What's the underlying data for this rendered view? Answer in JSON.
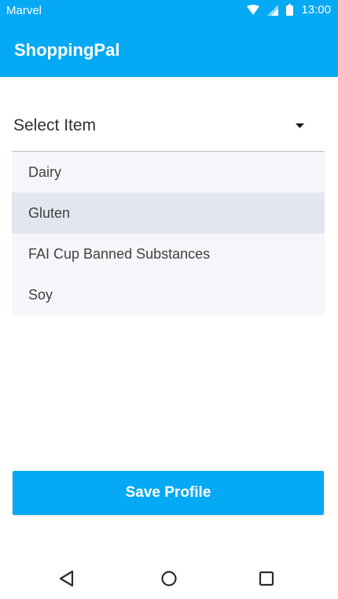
{
  "status_bar": {
    "carrier": "Marvel",
    "time": "13:00",
    "icons": [
      "wifi-icon",
      "signal-icon",
      "battery-icon"
    ]
  },
  "app_bar": {
    "title": "ShoppingPal"
  },
  "select": {
    "label": "Select Item",
    "icon": "caret-down-icon"
  },
  "dropdown": {
    "items": [
      {
        "label": "Dairy"
      },
      {
        "label": "Gluten"
      },
      {
        "label": "FAI Cup Banned Substances"
      },
      {
        "label": "Soy"
      }
    ],
    "highlighted_index": 1
  },
  "save_button": {
    "label": "Save Profile"
  },
  "nav_bar": {
    "icons": [
      "back-icon",
      "home-icon",
      "recents-icon"
    ]
  },
  "colors": {
    "accent": "#05a9f4",
    "dropdown_bg": "#f5f6fa",
    "highlight_bg": "#e2e6ef"
  }
}
